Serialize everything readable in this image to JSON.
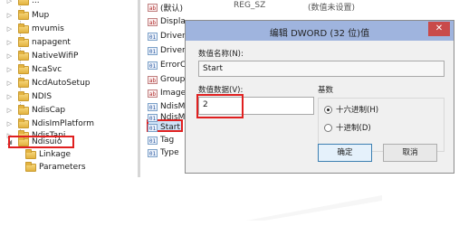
{
  "tree": {
    "items": [
      "Mup",
      "mvumis",
      "napagent",
      "NativeWifiP",
      "NcaSvc",
      "NcdAutoSetup",
      "NDIS",
      "NdisCap",
      "NdisImPlatform",
      "NdisTapi",
      "Ndisuio"
    ],
    "children": [
      "Linkage",
      "Parameters"
    ],
    "top_partial": "..."
  },
  "values_list": {
    "rows": [
      {
        "icon": "ab",
        "name": "(默认)"
      },
      {
        "icon": "ab",
        "name": "Displa"
      },
      {
        "icon": "01",
        "name": "DriverI"
      },
      {
        "icon": "01",
        "name": "DriverI"
      },
      {
        "icon": "01",
        "name": "ErrorC"
      },
      {
        "icon": "ab",
        "name": "Group"
      },
      {
        "icon": "ab",
        "name": "Image"
      },
      {
        "icon": "01",
        "name": "NdisM"
      },
      {
        "icon": "01",
        "name": "NdisM"
      },
      {
        "icon": "01",
        "name": "Start"
      },
      {
        "icon": "01",
        "name": "Tag"
      },
      {
        "icon": "01",
        "name": "Type"
      }
    ],
    "header_type": "REG_SZ",
    "header_data": "(数值未设置)"
  },
  "dialog": {
    "title": "编辑 DWORD (32 位)值",
    "close_glyph": "✕",
    "name_label": "数值名称(N):",
    "name_value": "Start",
    "data_label": "数值数据(V):",
    "data_value": "2",
    "base_label": "基数",
    "base_options": [
      "十六进制(H)",
      "十进制(D)"
    ],
    "base_selected": 0,
    "ok_label": "确定",
    "cancel_label": "取消"
  }
}
